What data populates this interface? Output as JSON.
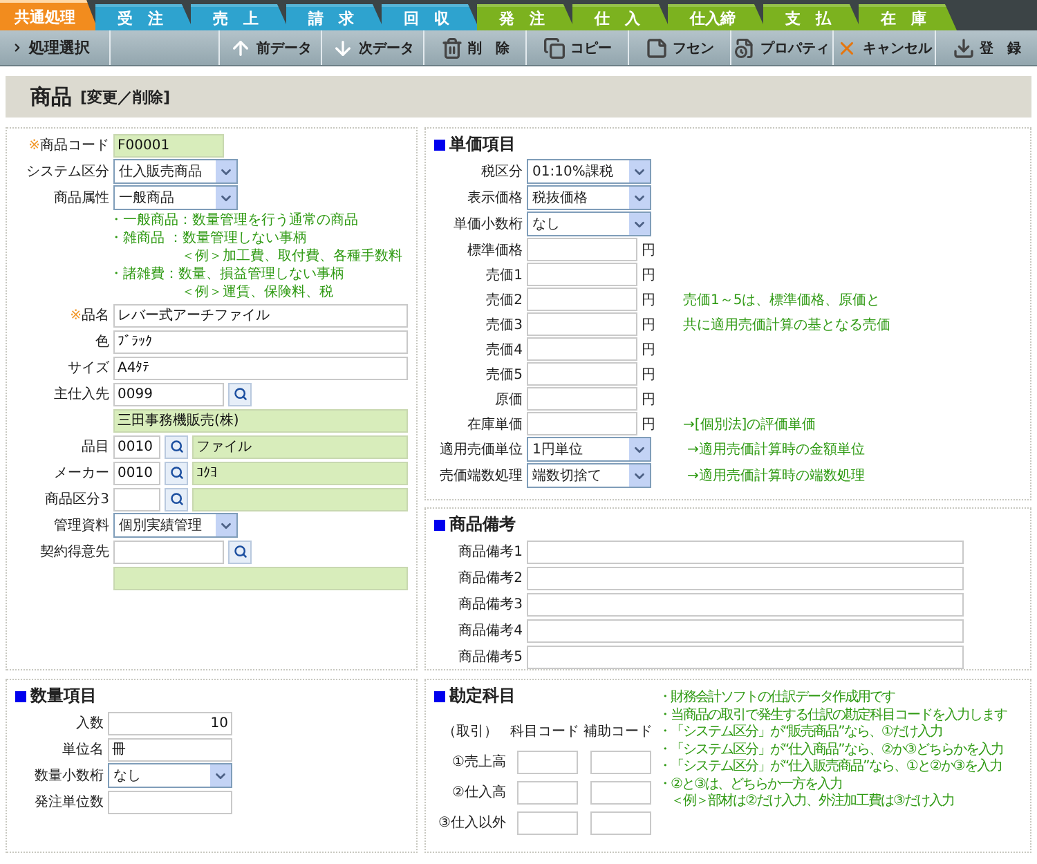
{
  "tabs": [
    {
      "label": "共通処理",
      "color": "#f28c1e",
      "selected": true
    },
    {
      "label": "受　注",
      "color": "#2ea3cf",
      "selected": false
    },
    {
      "label": "売　上",
      "color": "#2ea3cf",
      "selected": false
    },
    {
      "label": "請　求",
      "color": "#2ea3cf",
      "selected": false
    },
    {
      "label": "回　収",
      "color": "#2ea3cf",
      "selected": false
    },
    {
      "label": "発　注",
      "color": "#7cb21f",
      "selected": false
    },
    {
      "label": "仕　入",
      "color": "#7cb21f",
      "selected": false
    },
    {
      "label": "仕入締",
      "color": "#7cb21f",
      "selected": false
    },
    {
      "label": "支　払",
      "color": "#7cb21f",
      "selected": false
    },
    {
      "label": "在　庫",
      "color": "#7cb21f",
      "selected": false
    }
  ],
  "toolbar": {
    "menu": "処理選択",
    "buttons": [
      {
        "kind": "prev",
        "label": "前データ"
      },
      {
        "kind": "next",
        "label": "次データ"
      },
      {
        "kind": "delete",
        "label": "削　除"
      },
      {
        "kind": "copy",
        "label": "コピー"
      },
      {
        "kind": "note",
        "label": "フセン"
      },
      {
        "kind": "property",
        "label": "プロパティ"
      },
      {
        "kind": "cancel",
        "label": "キャンセル"
      },
      {
        "kind": "save",
        "label": "登　録"
      }
    ]
  },
  "page_title": {
    "title": "商品",
    "mode": "[変更／削除]"
  },
  "basic": {
    "rows": [
      {
        "kind": "code",
        "mark": "※",
        "label": "商品コード",
        "value": "F00001"
      },
      {
        "kind": "select",
        "label": "システム区分",
        "value": "仕入販売商品"
      },
      {
        "kind": "select",
        "label": "商品属性",
        "value": "一般商品"
      },
      {
        "kind": "notes",
        "lines": [
          {
            "kind": "item",
            "text": "・一般商品：数量管理を行う通常の商品"
          },
          {
            "kind": "item",
            "text": "・雑商品 ：数量管理しない事柄"
          },
          {
            "kind": "example",
            "text": "＜例＞加工費、取付費、各種手数料"
          },
          {
            "kind": "item",
            "text": "・諸雑費：数量、損益管理しない事柄"
          },
          {
            "kind": "example",
            "text": "＜例＞運賃、保険料、税"
          }
        ]
      },
      {
        "kind": "text",
        "mark": "※",
        "label": "品名",
        "value": "レバー式アーチファイル"
      },
      {
        "kind": "text",
        "label": "色",
        "value": "ﾌﾞﾗｯｸ"
      },
      {
        "kind": "text",
        "label": "サイズ",
        "value": "A4ﾀﾃ"
      },
      {
        "kind": "lookup-wide",
        "label": "主仕入先",
        "value": "0099"
      },
      {
        "kind": "name-line",
        "value": "三田事務機販売(株)"
      },
      {
        "kind": "lookup",
        "label": "品目",
        "value": "0010",
        "name": "ファイル"
      },
      {
        "kind": "lookup",
        "label": "メーカー",
        "value": "0010",
        "name": "ｺｸﾖ"
      },
      {
        "kind": "lookup",
        "label": "商品区分3"
      },
      {
        "kind": "select",
        "label": "管理資料",
        "value": "個別実績管理"
      },
      {
        "kind": "lookup-wide",
        "label": "契約得意先"
      },
      {
        "kind": "name-line"
      }
    ]
  },
  "price": {
    "title": "単価項目",
    "rows": [
      {
        "kind": "select",
        "label": "税区分",
        "value": "01:10%課税"
      },
      {
        "kind": "select",
        "label": "表示価格",
        "value": "税抜価格"
      },
      {
        "kind": "select",
        "label": "単価小数桁",
        "value": "なし"
      },
      {
        "kind": "yen",
        "label": "標準価格",
        "unit": "円"
      },
      {
        "kind": "yen",
        "label": "売価1",
        "unit": "円"
      },
      {
        "kind": "yen",
        "label": "売価2",
        "unit": "円",
        "note": "売価1～5は、標準価格、原価と"
      },
      {
        "kind": "yen",
        "label": "売価3",
        "unit": "円",
        "note": "共に適用売価計算の基となる売価"
      },
      {
        "kind": "yen",
        "label": "売価4",
        "unit": "円"
      },
      {
        "kind": "yen",
        "label": "売価5",
        "unit": "円"
      },
      {
        "kind": "yen",
        "label": "原価",
        "unit": "円"
      },
      {
        "kind": "yen",
        "label": "在庫単価",
        "unit": "円",
        "note": "→[個別法]の評価単価"
      },
      {
        "kind": "select",
        "label": "適用売価単位",
        "value": "1円単位",
        "note": "→適用売価計算時の金額単位"
      },
      {
        "kind": "select",
        "label": "売価端数処理",
        "value": "端数切捨て",
        "note": "→適用売価計算時の端数処理"
      }
    ]
  },
  "remarks": {
    "title": "商品備考",
    "rows": [
      {
        "label": "商品備考1"
      },
      {
        "label": "商品備考2"
      },
      {
        "label": "商品備考3"
      },
      {
        "label": "商品備考4"
      },
      {
        "label": "商品備考5"
      }
    ]
  },
  "quantity": {
    "title": "数量項目",
    "rows": [
      {
        "kind": "number",
        "label": "入数",
        "value": "10"
      },
      {
        "kind": "text",
        "label": "単位名",
        "value": "冊"
      },
      {
        "kind": "select",
        "label": "数量小数桁",
        "value": "なし"
      },
      {
        "kind": "text",
        "label": "発注単位数"
      }
    ]
  },
  "accounts": {
    "title": "勘定科目",
    "header": [
      "（取引）",
      "科目コード",
      "補助コード"
    ],
    "rows": [
      {
        "label": "①売上高"
      },
      {
        "label": "②仕入高"
      },
      {
        "label": "③仕入以外"
      }
    ],
    "notes": [
      "・財務会計ソフトの仕訳データ作成用です",
      "・当商品の取引で発生する仕訳の勘定科目コードを入力します",
      "・「システム区分」が“販売商品”なら、①だけ入力",
      "・「システム区分」が“仕入商品”なら、②か③どちらかを入力",
      "・「システム区分」が“仕入販売商品”なら、①と②か③を入力",
      "・②と③は、どちらか一方を入力",
      "　＜例＞部材は②だけ入力、外注加工費は③だけ入力"
    ]
  }
}
